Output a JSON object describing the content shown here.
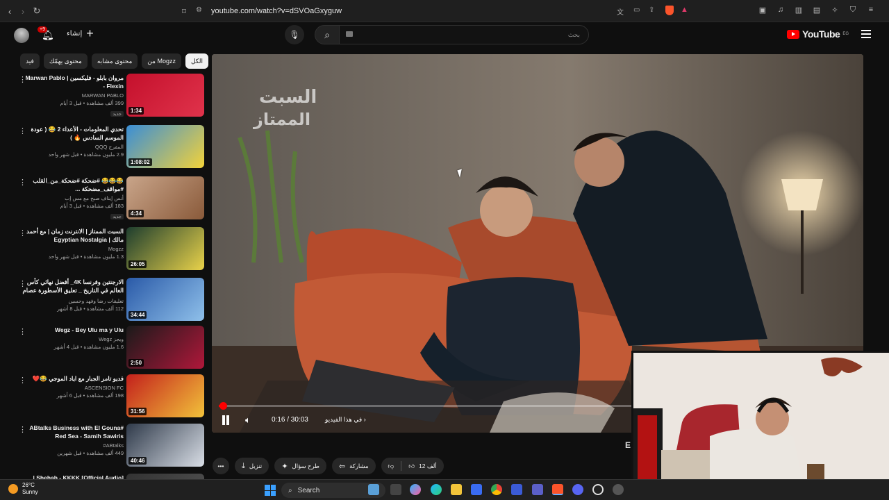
{
  "browser": {
    "url": "youtube.com/watch?v=dSVOaGxyguw"
  },
  "header": {
    "logo_text": "YouTube",
    "logo_region": "EG",
    "search_placeholder": "بحث",
    "create_label": "إنشاء",
    "notification_count": "+9"
  },
  "chips": [
    {
      "label": "الكل",
      "active": true
    },
    {
      "label": "من Mogzz",
      "active": false
    },
    {
      "label": "محتوى مشابه",
      "active": false
    },
    {
      "label": "محتوى يهمّك",
      "active": false
    },
    {
      "label": "فيد",
      "active": false
    }
  ],
  "recommendations": [
    {
      "title": "مروان بابلو - فليكسين | Marwan Pablo - Flexin",
      "channel": "MARWAN PABLO",
      "meta": "399 ألف مشاهدة • قبل 3 أيام",
      "badge": "جديد",
      "duration": "1:34"
    },
    {
      "title": "تحدي المعلومات - الأعداء 2 😂 ( عودة الموسم السادس 🔥 )",
      "channel": "المفرج QQQ",
      "meta": "2.9 مليون مشاهدة • قبل شهر واحد",
      "badge": "",
      "duration": "1:08:02"
    },
    {
      "title": "😂😂😂 #ضحكة #ضحكة_من_القلب #مواقف_مضحكة ...",
      "channel": "أنس إيناف صبح مع مس إب",
      "meta": "183 ألف مشاهدة • قبل 3 أيام",
      "badge": "جديد",
      "duration": "4:34"
    },
    {
      "title": "السبت الممتاز | الانترنت زمان | مع أحمد مالك | Egyptian Nostalgia",
      "channel": "Mogzz",
      "meta": "1.3 مليون مشاهدة • قبل شهر واحد",
      "badge": "",
      "duration": "26:05"
    },
    {
      "title": "الارجنتين وفرنسا 4K_ أفضل نهائي كأس العالم في التاريخ _ تعليق الأسطورة عصام ...",
      "channel": "تعليقات رضا وفهد وحسين",
      "meta": "112 ألف مشاهدة • قبل 8 أشهر",
      "badge": "",
      "duration": "34:44"
    },
    {
      "title": "Wegz - Bey Ulu ma y Ulu",
      "channel": "ويجز Wegz",
      "meta": "1.6 مليون مشاهدة • قبل 4 أشهر",
      "badge": "",
      "duration": "2:50"
    },
    {
      "title": "فديو تامر الجبار مع اياد الموجي 😂❤️",
      "channel": "ASCENSION FC",
      "meta": "198 ألف مشاهدة • قبل 6 أشهر",
      "badge": "",
      "duration": "31:56"
    },
    {
      "title": "#ABtalks Business with El Gouna Red Sea - Samih Sawiris",
      "channel": "ABtalks#",
      "meta": "449 ألف مشاهدة • قبل شهرين",
      "badge": "",
      "duration": "40:46"
    },
    {
      "title": "Shehab - KKKK [Official Audio] |",
      "channel": "",
      "meta": "",
      "badge": "",
      "duration": ""
    }
  ],
  "player": {
    "time": "0:16 / 30:03",
    "chapter": "في هذا الفيديو",
    "progress": 0.0089
  },
  "actions": {
    "likes": "12 ألف",
    "share": "مشاركة",
    "ask": "طرح سؤال",
    "download": "تنزيل"
  },
  "side_letter": "E",
  "taskbar": {
    "temp": "26°C",
    "weather": "Sunny",
    "search": "Search"
  },
  "colors": {
    "accent": "#ff0000",
    "background": "#0f0f0f",
    "chip": "#272727"
  }
}
